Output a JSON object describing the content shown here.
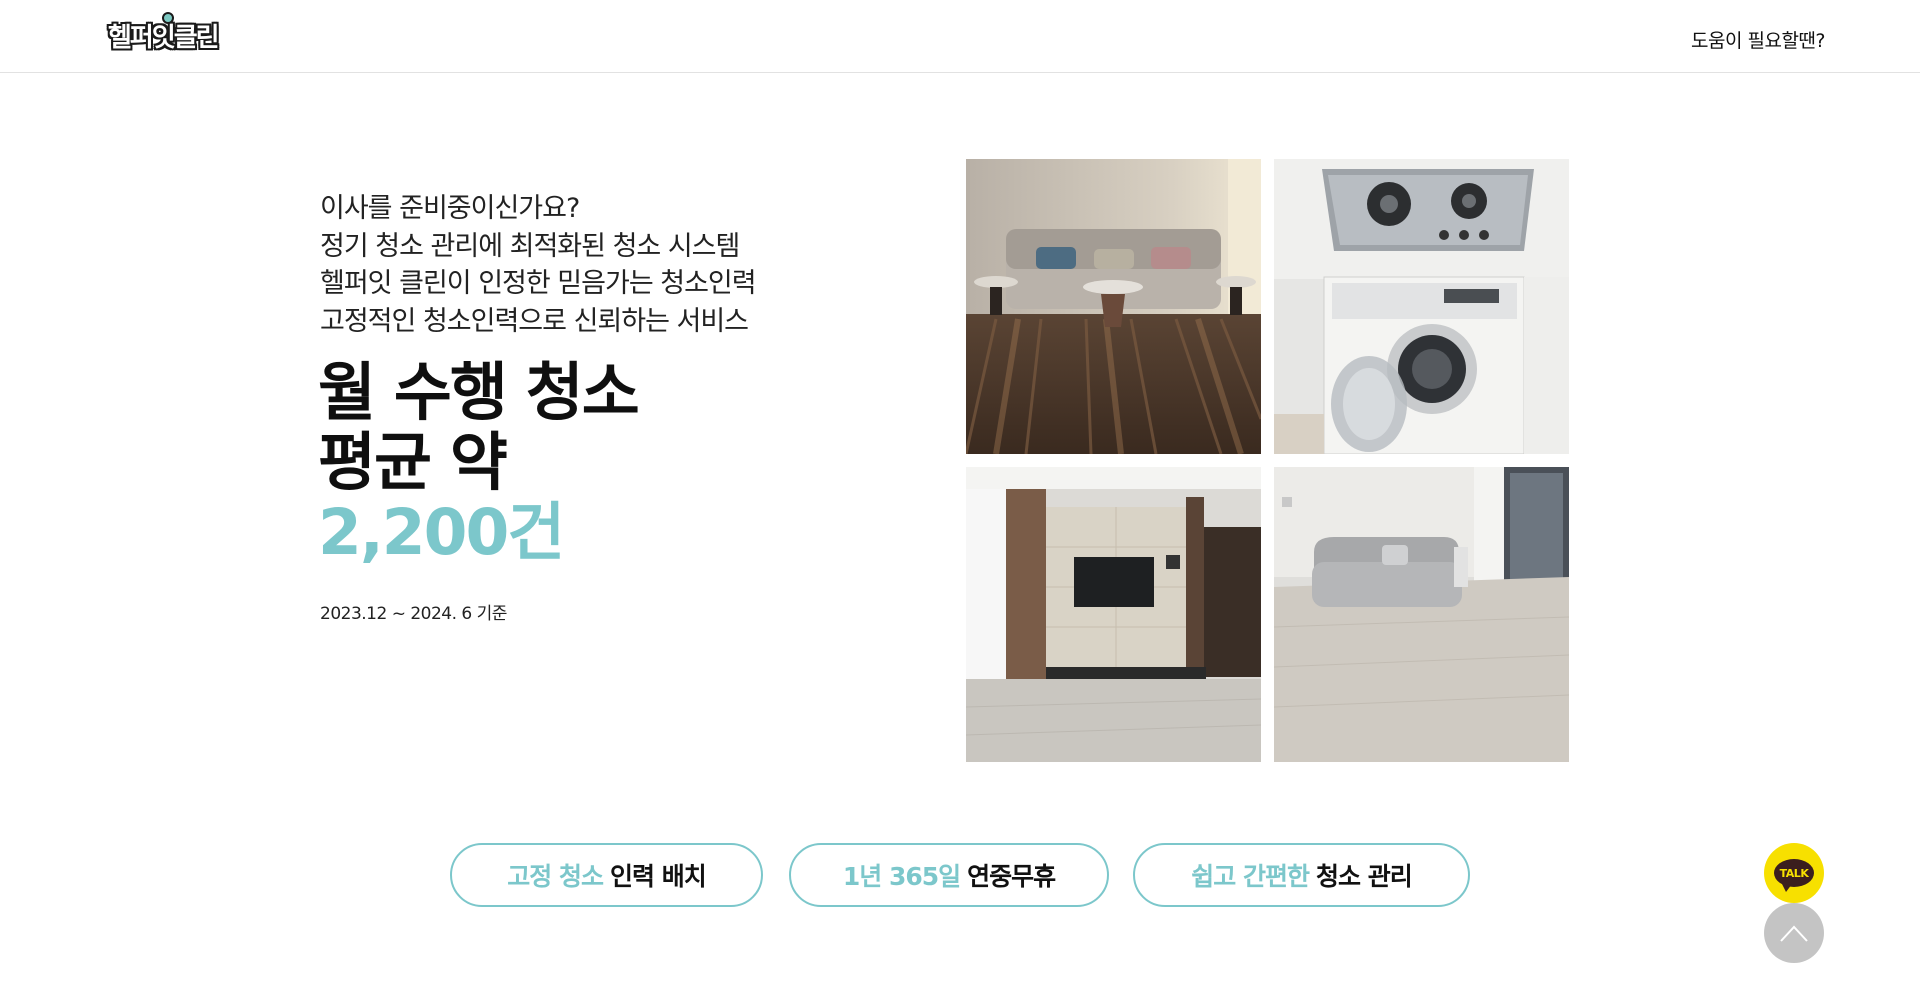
{
  "header": {
    "logo_text": "헬퍼잇클린",
    "help_link": "도움이 필요할땐?"
  },
  "intro": {
    "lines": [
      "이사를 준비중이신가요?",
      "정기 청소 관리에 최적화된 청소 시스템",
      "헬퍼잇 클린이 인정한 믿음가는 청소인력",
      "고정적인 청소인력으로 신뢰하는 서비스"
    ]
  },
  "stats": {
    "line1": "월 수행 청소",
    "line2": "평균 약",
    "value": "2,200건",
    "basis": "2023.12 ~ 2024. 6 기준"
  },
  "features": [
    {
      "accent": "고정 청소",
      "text": "인력 배치"
    },
    {
      "accent": "1년 365일",
      "text": "연중무휴"
    },
    {
      "accent": "쉽고 간편한",
      "text": "청소 관리"
    }
  ],
  "floating": {
    "talk_label": "TALK"
  },
  "colors": {
    "accent": "#7cc7cb",
    "talk_yellow": "#f7e000",
    "top_button": "#c4c4c4"
  }
}
